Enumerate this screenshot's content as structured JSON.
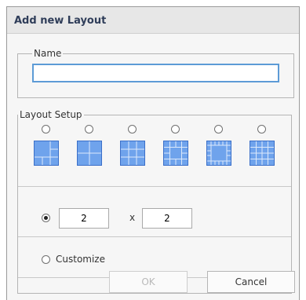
{
  "dialog": {
    "title": "Add new Layout"
  },
  "name_section": {
    "legend": "Name",
    "value": ""
  },
  "layout_setup": {
    "legend": "Layout Setup",
    "presets": [
      {
        "name": "layout-1-plus-5"
      },
      {
        "name": "layout-2x2"
      },
      {
        "name": "layout-3x3"
      },
      {
        "name": "layout-1-plus-12"
      },
      {
        "name": "layout-1-plus-15"
      },
      {
        "name": "layout-4x4"
      }
    ],
    "custom_grid": {
      "selected": true,
      "columns": "2",
      "times": "x",
      "rows": "2"
    },
    "customize": {
      "label": "Customize",
      "selected": false
    }
  },
  "buttons": {
    "ok": "OK",
    "ok_disabled": true,
    "cancel": "Cancel"
  },
  "colors": {
    "tile_fill": "#6fa3ec",
    "tile_border": "#3b6fc8",
    "focus_border": "#5d9bd6",
    "title_text": "#2f3d59"
  }
}
